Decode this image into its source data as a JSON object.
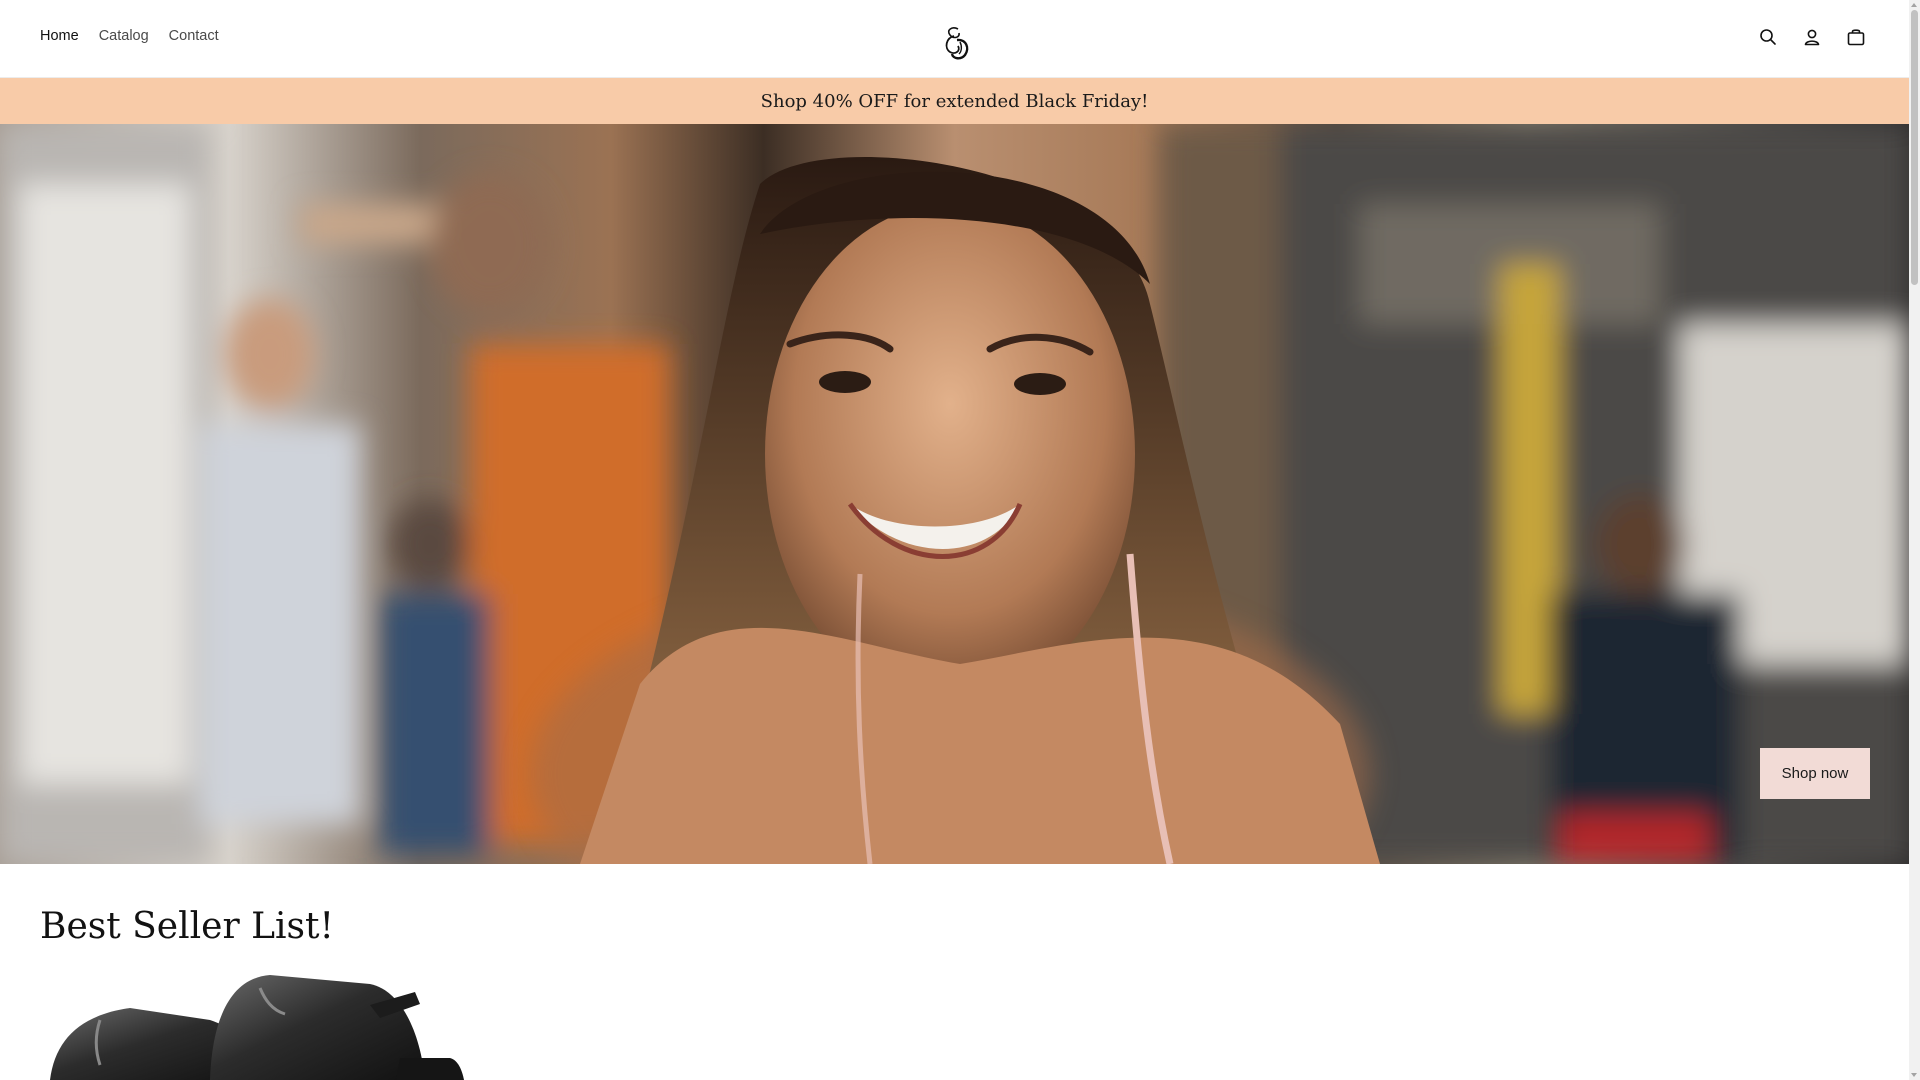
{
  "nav": {
    "items": [
      {
        "label": "Home",
        "active": true
      },
      {
        "label": "Catalog",
        "active": false
      },
      {
        "label": "Contact",
        "active": false
      }
    ]
  },
  "header": {
    "logo": "store-logo",
    "icons": [
      "search-icon",
      "account-icon",
      "cart-icon"
    ]
  },
  "announcement": {
    "text": "Shop 40% OFF for extended Black Friday!",
    "background": "#f8cba8"
  },
  "hero": {
    "button_label": "Shop now",
    "button_color": "#f2dbd6",
    "image": "smiling-woman-at-gym"
  },
  "best_sellers": {
    "title": "Best Seller List!",
    "first_product_image": "black-kettlebells"
  }
}
